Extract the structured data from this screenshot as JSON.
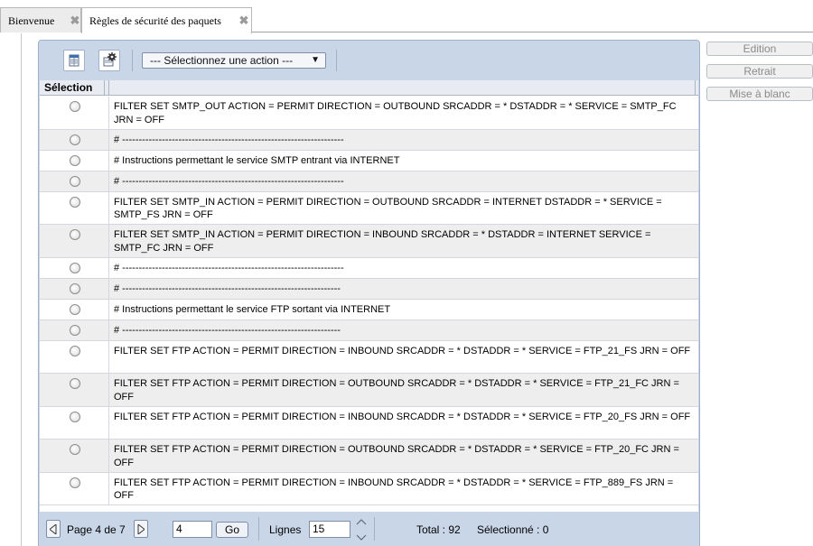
{
  "tabs": [
    {
      "label": "Bienvenue",
      "close": "✖"
    },
    {
      "label": "Règles de sécurité des paquets",
      "close": "✖"
    }
  ],
  "toolbar": {
    "action_select": "--- Sélectionnez une action ---"
  },
  "table": {
    "header_selection": "Sélection",
    "rows": [
      "FILTER SET SMTP_OUT ACTION = PERMIT DIRECTION = OUTBOUND SRCADDR = * DSTADDR = * SERVICE = SMTP_FC JRN = OFF",
      "# -------------------------------------------------------------------",
      "# Instructions permettant le service SMTP entrant via INTERNET",
      "# -------------------------------------------------------------------",
      "FILTER SET SMTP_IN ACTION = PERMIT DIRECTION = OUTBOUND SRCADDR = INTERNET DSTADDR = * SERVICE = SMTP_FS JRN = OFF",
      "FILTER SET SMTP_IN ACTION = PERMIT DIRECTION = INBOUND SRCADDR = * DSTADDR = INTERNET SERVICE = SMTP_FC JRN = OFF",
      "# -------------------------------------------------------------------",
      "# ------------------------------------------------------------------",
      "# Instructions permettant le service FTP sortant via INTERNET",
      "# ------------------------------------------------------------------",
      "FILTER SET FTP ACTION = PERMIT DIRECTION = INBOUND SRCADDR = * DSTADDR = * SERVICE = FTP_21_FS JRN = OFF",
      "FILTER SET FTP ACTION = PERMIT DIRECTION = OUTBOUND SRCADDR = * DSTADDR = * SERVICE = FTP_21_FC JRN = OFF",
      "FILTER SET FTP ACTION = PERMIT DIRECTION = INBOUND SRCADDR = * DSTADDR = * SERVICE = FTP_20_FS JRN = OFF",
      "FILTER SET FTP ACTION = PERMIT DIRECTION = OUTBOUND SRCADDR = * DSTADDR = * SERVICE = FTP_20_FC JRN = OFF",
      "FILTER SET FTP ACTION = PERMIT DIRECTION = INBOUND SRCADDR = * DSTADDR = * SERVICE = FTP_889_FS JRN = OFF"
    ]
  },
  "footer": {
    "page_label": "Page 4 de 7",
    "page_input": "4",
    "go_label": "Go",
    "lines_label": "Lignes",
    "lines_input": "15",
    "total_label": "Total : 92",
    "selected_label": "Sélectionné : 0"
  },
  "side_buttons": {
    "edit": "Edition",
    "withdraw": "Retrait",
    "reset": "Mise à blanc"
  },
  "colors": {
    "panel": "#c9d6e8",
    "row_alt": "#eeeeee",
    "disabled_text": "#8a8a8a"
  }
}
